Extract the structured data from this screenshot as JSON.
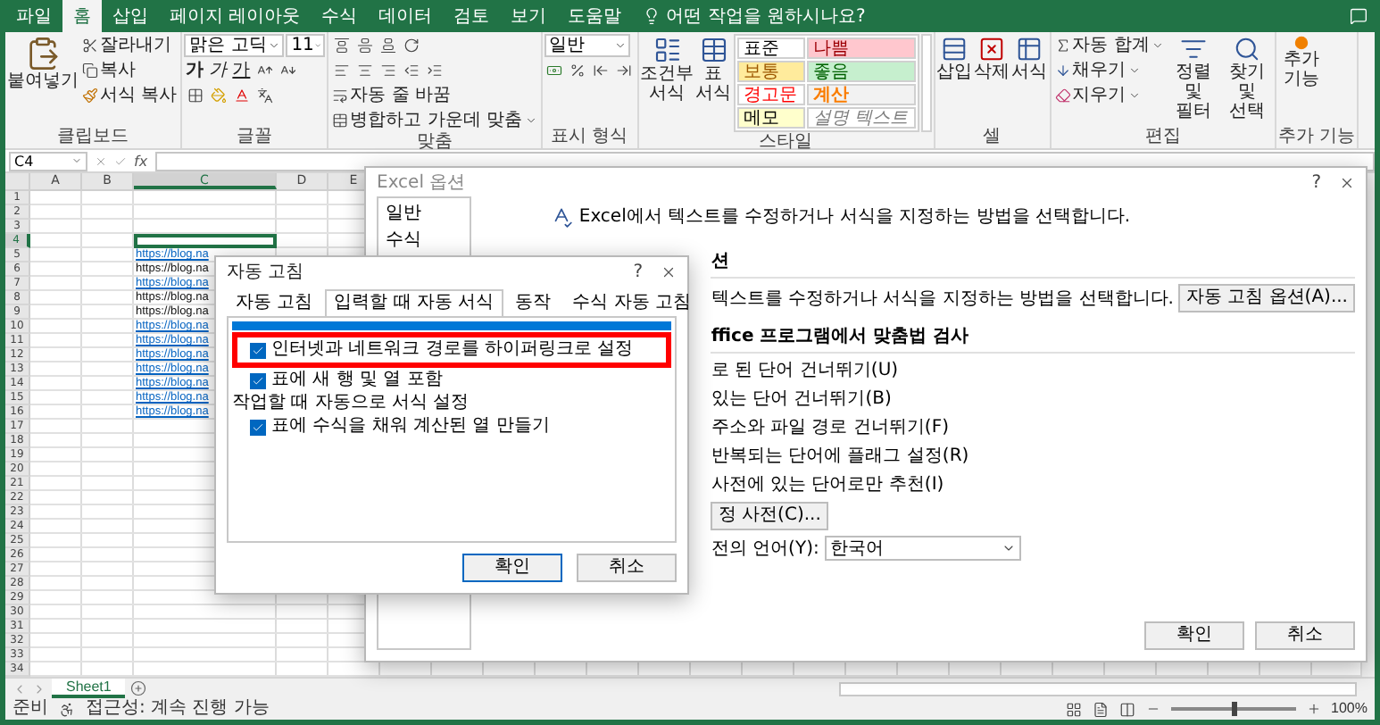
{
  "top_bar": {
    "tabs": [
      {
        "label": "파일",
        "selected": false
      },
      {
        "label": "홈",
        "selected": true
      },
      {
        "label": "삽입",
        "selected": false
      },
      {
        "label": "페이지 레이아웃",
        "selected": false
      },
      {
        "label": "수식",
        "selected": false
      },
      {
        "label": "데이터",
        "selected": false
      },
      {
        "label": "검토",
        "selected": false
      },
      {
        "label": "보기",
        "selected": false
      },
      {
        "label": "도움말",
        "selected": false
      }
    ],
    "search_hint": "어떤 작업을 원하시나요?"
  },
  "ribbon": {
    "clipboard": {
      "paste": "붙여넣기",
      "cut": "잘라내기",
      "copy": "복사",
      "format_painter": "서식 복사",
      "label": "클립보드"
    },
    "font": {
      "name": "맑은 고딕",
      "size": "11",
      "style_buttons": [
        {
          "text": "가",
          "kind": "bold"
        },
        {
          "text": "가",
          "kind": "italic"
        },
        {
          "text": "가",
          "kind": "underline"
        }
      ],
      "label": "글꼴"
    },
    "alignment": {
      "wrap": "자동 줄 바꿈",
      "merge": "병합하고 가운데 맞춤",
      "label": "맞춤"
    },
    "number": {
      "format": "일반",
      "label": "표시 형식"
    },
    "styles": {
      "conditional": "조건부 서식",
      "table": "표 서식",
      "cells": [
        {
          "text": "표준",
          "kind": "normal",
          "color": "#ffffff"
        },
        {
          "text": "나쁨",
          "kind": "bad",
          "color": "#ffc7ce"
        },
        {
          "text": "보통",
          "kind": "neutral",
          "color": "#ffeb9c"
        },
        {
          "text": "좋음",
          "kind": "good",
          "color": "#c6efce"
        },
        {
          "text": "경고문",
          "kind": "warning",
          "color": "#ffffff"
        },
        {
          "text": "계산",
          "kind": "calculation",
          "color": "#f2f2f2"
        },
        {
          "text": "메모",
          "kind": "note",
          "color": "#ffffcc"
        },
        {
          "text": "설명 텍스트",
          "kind": "explanatory",
          "color": "#ffffff"
        }
      ],
      "label": "스타일"
    },
    "cells": {
      "buttons": [
        "삽입",
        "삭제",
        "서식"
      ],
      "label": "셀"
    },
    "editing": {
      "autosum": "자동 합계",
      "fill": "채우기",
      "clear": "지우기",
      "sort": "정렬 및 필터",
      "find": "찾기 및 선택",
      "label": "편집"
    },
    "addins": {
      "button": "추가 기능",
      "label": "추가 기능"
    }
  },
  "formula_bar": {
    "name_box": "C4",
    "function_label": "fx"
  },
  "sheet": {
    "columns": [
      {
        "label": "A",
        "selected": false
      },
      {
        "label": "B",
        "selected": false
      },
      {
        "label": "C",
        "selected": true
      },
      {
        "label": "D",
        "selected": false
      },
      {
        "label": "E",
        "selected": false
      }
    ],
    "rows": [
      {
        "number": "1",
        "selected": false
      },
      {
        "number": "2",
        "selected": false
      },
      {
        "number": "3",
        "selected": false
      },
      {
        "number": "4",
        "selected": true
      },
      {
        "number": "5",
        "selected": false,
        "cell_c": {
          "text": "https://blog.na",
          "kind": "link"
        }
      },
      {
        "number": "6",
        "selected": false,
        "cell_c": {
          "text": "https://blog.na",
          "kind": "text"
        }
      },
      {
        "number": "7",
        "selected": false,
        "cell_c": {
          "text": "https://blog.na",
          "kind": "link"
        }
      },
      {
        "number": "8",
        "selected": false,
        "cell_c": {
          "text": "https://blog.na",
          "kind": "text"
        }
      },
      {
        "number": "9",
        "selected": false,
        "cell_c": {
          "text": "https://blog.na",
          "kind": "text"
        }
      },
      {
        "number": "10",
        "selected": false,
        "cell_c": {
          "text": "https://blog.na",
          "kind": "link"
        }
      },
      {
        "number": "11",
        "selected": false,
        "cell_c": {
          "text": "https://blog.na",
          "kind": "link"
        }
      },
      {
        "number": "12",
        "selected": false,
        "cell_c": {
          "text": "https://blog.na",
          "kind": "link"
        }
      },
      {
        "number": "13",
        "selected": false,
        "cell_c": {
          "text": "https://blog.na",
          "kind": "link"
        }
      },
      {
        "number": "14",
        "selected": false,
        "cell_c": {
          "text": "https://blog.na",
          "kind": "link"
        }
      },
      {
        "number": "15",
        "selected": false,
        "cell_c": {
          "text": "https://blog.na",
          "kind": "link"
        }
      },
      {
        "number": "16",
        "selected": false,
        "cell_c": {
          "text": "https://blog.na",
          "kind": "link"
        }
      },
      {
        "number": "17",
        "selected": false
      },
      {
        "number": "18",
        "selected": false
      },
      {
        "number": "19",
        "selected": false
      },
      {
        "number": "20",
        "selected": false
      },
      {
        "number": "21",
        "selected": false
      },
      {
        "number": "22",
        "selected": false
      },
      {
        "number": "23",
        "selected": false
      },
      {
        "number": "24",
        "selected": false
      },
      {
        "number": "25",
        "selected": false
      },
      {
        "number": "26",
        "selected": false
      },
      {
        "number": "27",
        "selected": false
      },
      {
        "number": "28",
        "selected": false
      },
      {
        "number": "29",
        "selected": false
      },
      {
        "number": "30",
        "selected": false
      },
      {
        "number": "31",
        "selected": false
      },
      {
        "number": "32",
        "selected": false
      },
      {
        "number": "33",
        "selected": false
      },
      {
        "number": "34",
        "selected": false
      }
    ]
  },
  "sheet_tabs": [
    {
      "label": "Sheet1",
      "selected": true
    }
  ],
  "status_bar": {
    "mode": "준비",
    "accessibility": "접근성: 계속 진행 가능",
    "zoom": {
      "level": 0.5,
      "reading": "100%"
    }
  },
  "options_dialog": {
    "title": "Excel 옵션",
    "help": "?",
    "nav": [
      "일반",
      "수식"
    ],
    "intro": "Excel에서 텍스트를 수정하거나 서식을 지정하는 방법을 선택합니다.",
    "sections": [
      {
        "heading": "션",
        "rows": [
          {
            "kind": "button_row",
            "text": "텍스트를 수정하거나 서식을 지정하는 방법을 선택합니다.",
            "button": "자동 고침 옵션(A)..."
          }
        ]
      },
      {
        "heading": "ffice 프로그램에서 맞춤법 검사",
        "rows": [
          {
            "kind": "text",
            "text": "로 된 단어 건너뛰기(U)"
          },
          {
            "kind": "text",
            "text": "있는 단어 건너뛰기(B)"
          },
          {
            "kind": "text",
            "text": "주소와 파일 경로 건너뛰기(F)"
          },
          {
            "kind": "text",
            "text": "반복되는 단어에 플래그 설정(R)"
          },
          {
            "kind": "text",
            "text": "사전에 있는 단어로만 추천(I)"
          },
          {
            "kind": "button",
            "text": "정 사전(C)..."
          },
          {
            "kind": "select",
            "text": "전의 언어(Y):",
            "value": "한국어"
          }
        ]
      }
    ],
    "buttons": [
      {
        "label": "확인",
        "default": false
      },
      {
        "label": "취소",
        "default": false
      }
    ]
  },
  "autocorrect_dialog": {
    "title": "자동 고침",
    "help": "?",
    "tabs": [
      {
        "label": "자동 고침",
        "selected": false
      },
      {
        "label": "입력할 때 자동 서식",
        "selected": true
      },
      {
        "label": "동작",
        "selected": false
      },
      {
        "label": "수식 자동 고침",
        "selected": false
      }
    ],
    "items": [
      {
        "kind": "checkbox",
        "label": "인터넷과 네트워크 경로를 하이퍼링크로 설정",
        "checked": true,
        "annotated": true
      },
      {
        "kind": "checkbox",
        "label": "표에 새 행 및 열 포함",
        "checked": true,
        "annotated": false
      },
      {
        "kind": "heading",
        "label": "작업할 때 자동으로 서식 설정"
      },
      {
        "kind": "checkbox",
        "label": "표에 수식을 채워 계산된 열 만들기",
        "checked": true,
        "annotated": false
      }
    ],
    "buttons": [
      {
        "label": "확인",
        "default": true
      },
      {
        "label": "취소",
        "default": false
      }
    ]
  }
}
